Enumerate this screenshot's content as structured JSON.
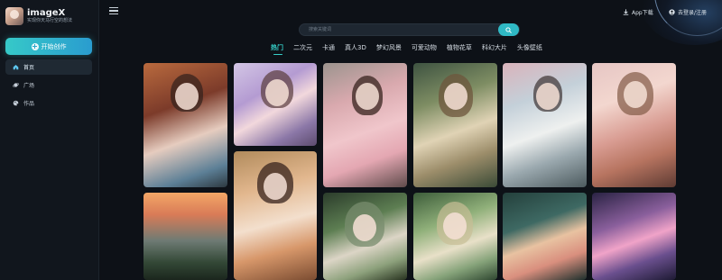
{
  "app": {
    "name": "imageX",
    "tagline": "实现你天马行空的想法"
  },
  "sidebar": {
    "create_label": "开始创作",
    "items": [
      {
        "label": "首页",
        "icon": "home-icon",
        "active": true
      },
      {
        "label": "广场",
        "icon": "planet-icon",
        "active": false
      },
      {
        "label": "作品",
        "icon": "palette-icon",
        "active": false
      }
    ]
  },
  "header": {
    "search_placeholder": "搜索关键词",
    "download_label": "App下载",
    "login_label": "去登录/注册"
  },
  "tabs": [
    {
      "label": "热门",
      "active": true
    },
    {
      "label": "二次元",
      "active": false
    },
    {
      "label": "卡通",
      "active": false
    },
    {
      "label": "真人3D",
      "active": false
    },
    {
      "label": "梦幻风景",
      "active": false
    },
    {
      "label": "可爱动物",
      "active": false
    },
    {
      "label": "植物花草",
      "active": false
    },
    {
      "label": "科幻大片",
      "active": false
    },
    {
      "label": "头像壁纸",
      "active": false
    }
  ],
  "colors": {
    "accent": "#36d0c9",
    "background": "#0d1117",
    "sidebar": "#11161d"
  }
}
